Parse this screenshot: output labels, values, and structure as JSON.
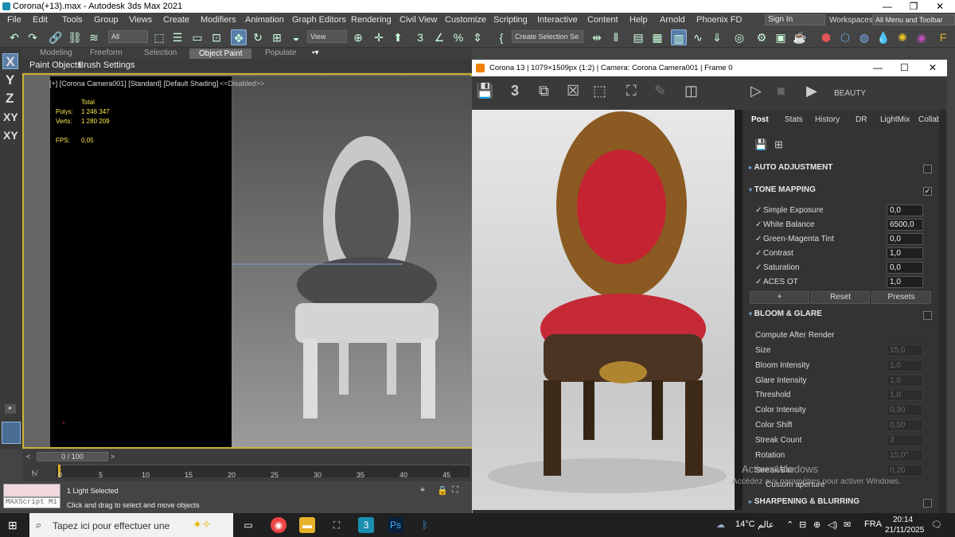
{
  "titlebar": {
    "title": "Corona(+13).max - Autodesk 3ds Max 2021",
    "min": "—",
    "max": "❐",
    "close": "✕"
  },
  "menu": [
    "File",
    "Edit",
    "Tools",
    "Group",
    "Views",
    "Create",
    "Modifiers",
    "Animation",
    "Graph Editors",
    "Rendering",
    "Civil View",
    "Customize",
    "Scripting",
    "Interactive",
    "Content",
    "Help",
    "Arnold",
    "Phoenix FD"
  ],
  "signin": "Sign In",
  "workspaces_label": "Workspaces:",
  "workspaces_value": "All Menu and Toolbar",
  "toolbar": {
    "filter": "All",
    "refcoord": "View",
    "selection_set": "Create Selection Se"
  },
  "ribbon_tabs": [
    "Modeling",
    "Freeform",
    "Selection",
    "Object Paint",
    "Populate"
  ],
  "ribbon_active": "Object Paint",
  "subribbon": [
    "Paint Objects",
    "Brush Settings"
  ],
  "axes": [
    "X",
    "Y",
    "Z",
    "XY",
    "XY"
  ],
  "viewport": {
    "label": "[+] [Corona Camera001] [Standard] [Default Shading]",
    "disabled": "<<Disabled>>",
    "stats_title": "Total",
    "polys_label": "Polys:",
    "polys": "1 246 347",
    "verts_label": "Verts:",
    "verts": "1 280 209",
    "fps_label": "FPS:",
    "fps": "0,05"
  },
  "timeline": {
    "slider": "0 / 100",
    "ticks": [
      "0",
      "5",
      "10",
      "15",
      "20",
      "25",
      "30",
      "35",
      "40",
      "45"
    ]
  },
  "status": {
    "maxscript": "MAXScript Mi",
    "selected": "1 Light Selected",
    "hint": "Click and drag to select and move objects"
  },
  "corona": {
    "title": "Corona 13 | 1079×1509px (1:2) | Camera: Corona Camera001 | Frame 0",
    "beauty": "BEAUTY",
    "tabs": [
      "Post",
      "Stats",
      "History",
      "DR",
      "LightMix",
      "Collab"
    ],
    "active_tab": "Post",
    "auto_adjust": "AUTO ADJUSTMENT",
    "tone_mapping": "TONE MAPPING",
    "tone_rows": [
      {
        "label": "Simple Exposure",
        "value": "0,0"
      },
      {
        "label": "White Balance",
        "value": "6500,0"
      },
      {
        "label": "Green-Magenta Tint",
        "value": "0,0"
      },
      {
        "label": "Contrast",
        "value": "1,0"
      },
      {
        "label": "Saturation",
        "value": "0,0"
      },
      {
        "label": "ACES OT",
        "value": "1,0"
      }
    ],
    "btn_add": "+",
    "btn_reset": "Reset",
    "btn_presets": "Presets",
    "bloom": "BLOOM & GLARE",
    "bloom_rows": [
      {
        "label": "Compute After Render",
        "value": ""
      },
      {
        "label": "Size",
        "value": "15,0"
      },
      {
        "label": "Bloom Intensity",
        "value": "1,0"
      },
      {
        "label": "Glare Intensity",
        "value": "1,0"
      },
      {
        "label": "Threshold",
        "value": "1,0"
      },
      {
        "label": "Color Intensity",
        "value": "0,30"
      },
      {
        "label": "Color Shift",
        "value": "0,50"
      },
      {
        "label": "Streak Count",
        "value": "3"
      },
      {
        "label": "Rotation",
        "value": "15,0°"
      },
      {
        "label": "Streak Blur",
        "value": "0,20"
      },
      {
        "label": "Custom aperture",
        "value": ""
      }
    ],
    "sharpen": "SHARPENING & BLURRING",
    "watermark1": "Activer Windows",
    "watermark2": "Accédez aux paramètres pour activer Windows."
  },
  "taskbar": {
    "search": "Tapez ici pour effectuer une",
    "temp": "14°C",
    "weather": "عالم",
    "lang": "FRA",
    "time": "20:14",
    "date": "21/11/2025"
  }
}
